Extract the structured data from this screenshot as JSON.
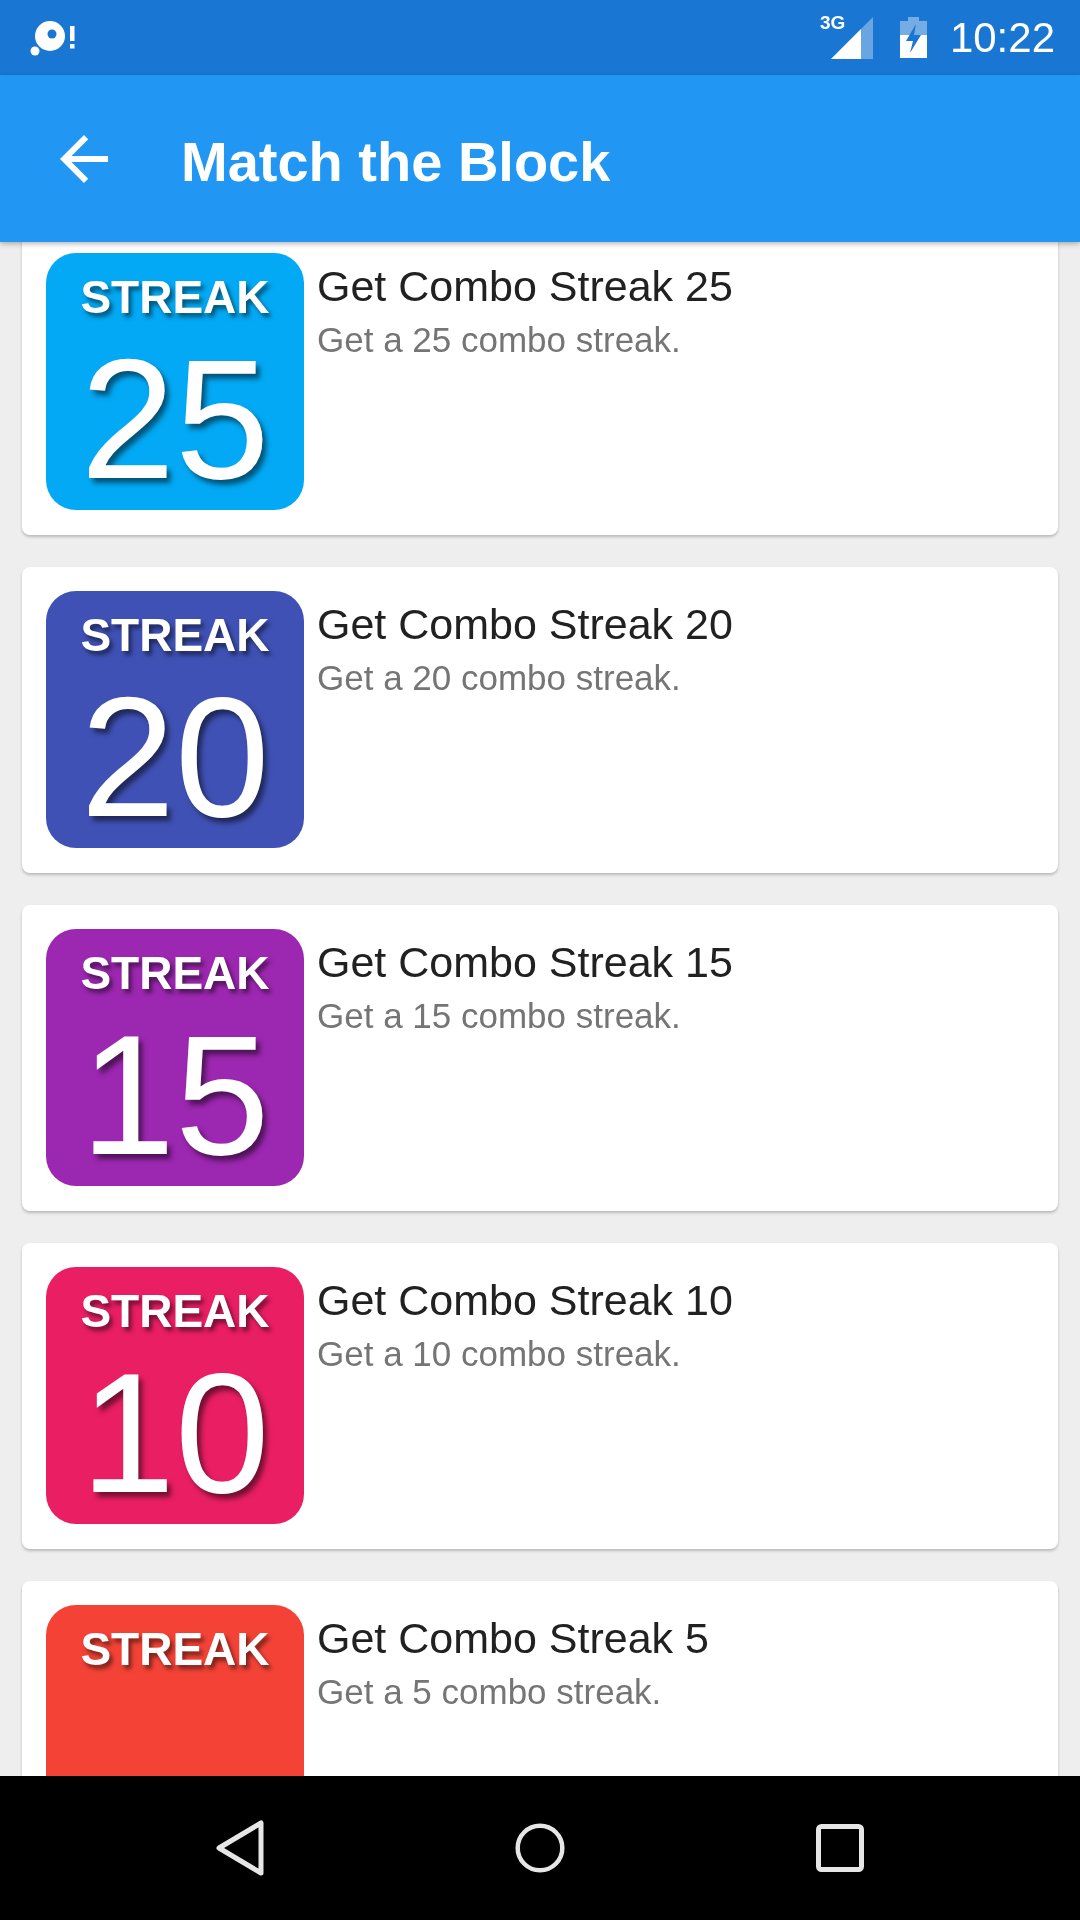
{
  "status_bar": {
    "network": "3G",
    "time": "10:22"
  },
  "app_bar": {
    "title": "Match the Block"
  },
  "achievements": [
    {
      "badge_label": "STREAK",
      "badge_number": "25",
      "color": "#03a9f4",
      "title": "Get Combo Streak 25",
      "description": "Get a 25 combo streak."
    },
    {
      "badge_label": "STREAK",
      "badge_number": "20",
      "color": "#3f51b5",
      "title": "Get Combo Streak 20",
      "description": "Get a 20 combo streak."
    },
    {
      "badge_label": "STREAK",
      "badge_number": "15",
      "color": "#9c27b0",
      "title": "Get Combo Streak 15",
      "description": "Get a 15 combo streak."
    },
    {
      "badge_label": "STREAK",
      "badge_number": "10",
      "color": "#e91e63",
      "title": "Get Combo Streak 10",
      "description": "Get a 10 combo streak."
    },
    {
      "badge_label": "STREAK",
      "color": "#f44336",
      "title": "Get Combo Streak 5",
      "description": "Get a 5 combo streak."
    }
  ]
}
